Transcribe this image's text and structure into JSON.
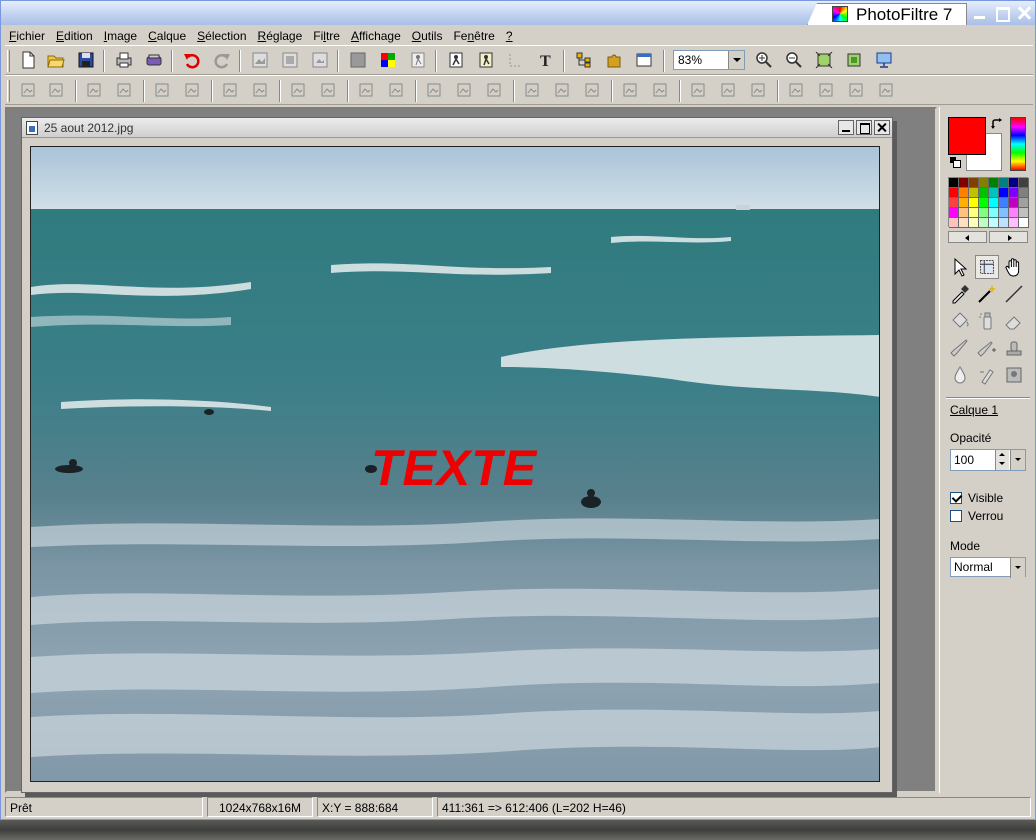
{
  "app": {
    "title": "PhotoFiltre 7"
  },
  "menu": [
    {
      "prefix": "",
      "underline": "F",
      "rest": "ichier"
    },
    {
      "prefix": "",
      "underline": "E",
      "rest": "dition"
    },
    {
      "prefix": "",
      "underline": "I",
      "rest": "mage"
    },
    {
      "prefix": "",
      "underline": "C",
      "rest": "alque"
    },
    {
      "prefix": "",
      "underline": "S",
      "rest": "élection"
    },
    {
      "prefix": "",
      "underline": "R",
      "rest": "églage"
    },
    {
      "prefix": "Fi",
      "underline": "l",
      "rest": "tre"
    },
    {
      "prefix": "",
      "underline": "A",
      "rest": "ffichage"
    },
    {
      "prefix": "",
      "underline": "O",
      "rest": "utils"
    },
    {
      "prefix": "Fe",
      "underline": "n",
      "rest": "être"
    },
    {
      "prefix": "",
      "underline": "?",
      "rest": ""
    }
  ],
  "toolbar": {
    "zoom_value": "83%"
  },
  "document": {
    "title": "25 aout 2012.jpg",
    "overlay_text": "TEXTE"
  },
  "colors": {
    "foreground": "#ff0000",
    "background": "#ffffff",
    "text_overlay": "#ee0000"
  },
  "layer_panel": {
    "layer_name": "Calque 1",
    "opacity_label": "Opacité",
    "opacity_value": "100",
    "visible_label": "Visible",
    "visible_checked": true,
    "lock_label": "Verrou",
    "lock_checked": false,
    "mode_label": "Mode",
    "mode_value": "Normal"
  },
  "status": {
    "state": "Prêt",
    "image_info": "1024x768x16M",
    "cursor": "X:Y = 888:684",
    "selection": "411:361 => 612:406 (L=202  H=46)"
  }
}
